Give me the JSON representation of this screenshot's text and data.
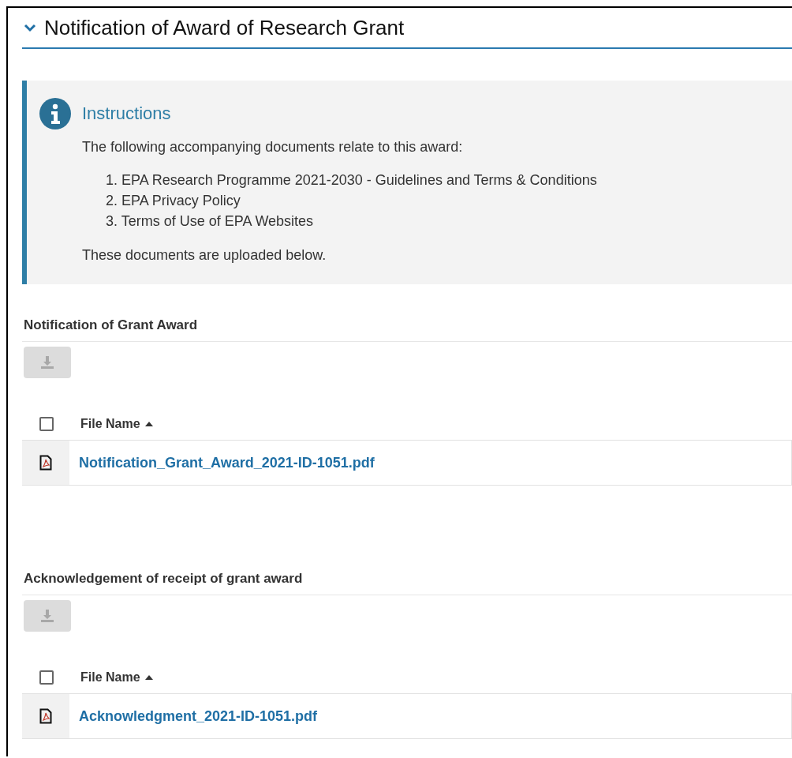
{
  "section": {
    "title": "Notification of Award of Research Grant",
    "expanded": true
  },
  "instructions": {
    "title": "Instructions",
    "intro": "The following accompanying documents relate to this award:",
    "items": [
      "1. EPA Research Programme 2021-2030 - Guidelines and Terms & Conditions",
      "2. EPA Privacy Policy",
      "3. Terms of Use of EPA Websites"
    ],
    "outro": "These documents are uploaded below."
  },
  "attachments": [
    {
      "heading": "Notification of Grant Award",
      "download_disabled": true,
      "select_all_checked": false,
      "column": "File Name",
      "files": [
        "Notification_Grant_Award_2021-ID-1051.pdf"
      ]
    },
    {
      "heading": "Acknowledgement of receipt of grant award",
      "download_disabled": true,
      "select_all_checked": false,
      "column": "File Name",
      "files": [
        "Acknowledgment_2021-ID-1051.pdf"
      ]
    }
  ]
}
